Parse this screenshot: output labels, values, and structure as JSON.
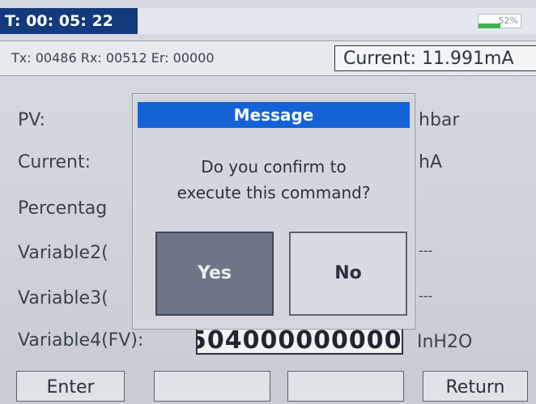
{
  "status_bar": {
    "timer": "T: 00: 05: 22",
    "battery_text": "52%",
    "battery_level": 0.52,
    "accent_color": "#123a7c"
  },
  "comm_line": {
    "counters": "Tx: 00486 Rx: 00512 Er: 00000",
    "current": "Current: 11.991mA"
  },
  "rows": [
    {
      "label": "PV:",
      "unit": "hbar"
    },
    {
      "label": "Current:",
      "unit": "hA"
    },
    {
      "label": "Percentag",
      "unit": ""
    },
    {
      "label": "Variable2(",
      "unit": "---"
    },
    {
      "label": "Variable3(",
      "unit": "---"
    },
    {
      "label": "Variable4(FV):",
      "value": "504000000000",
      "unit": "InH2O"
    }
  ],
  "dialog": {
    "title": "Message",
    "message_line1": "Do you confirm to",
    "message_line2": "execute this command?",
    "yes_label": "Yes",
    "no_label": "No",
    "title_color": "#1463d6"
  },
  "softkeys": [
    "Enter",
    "",
    "",
    "Return"
  ]
}
